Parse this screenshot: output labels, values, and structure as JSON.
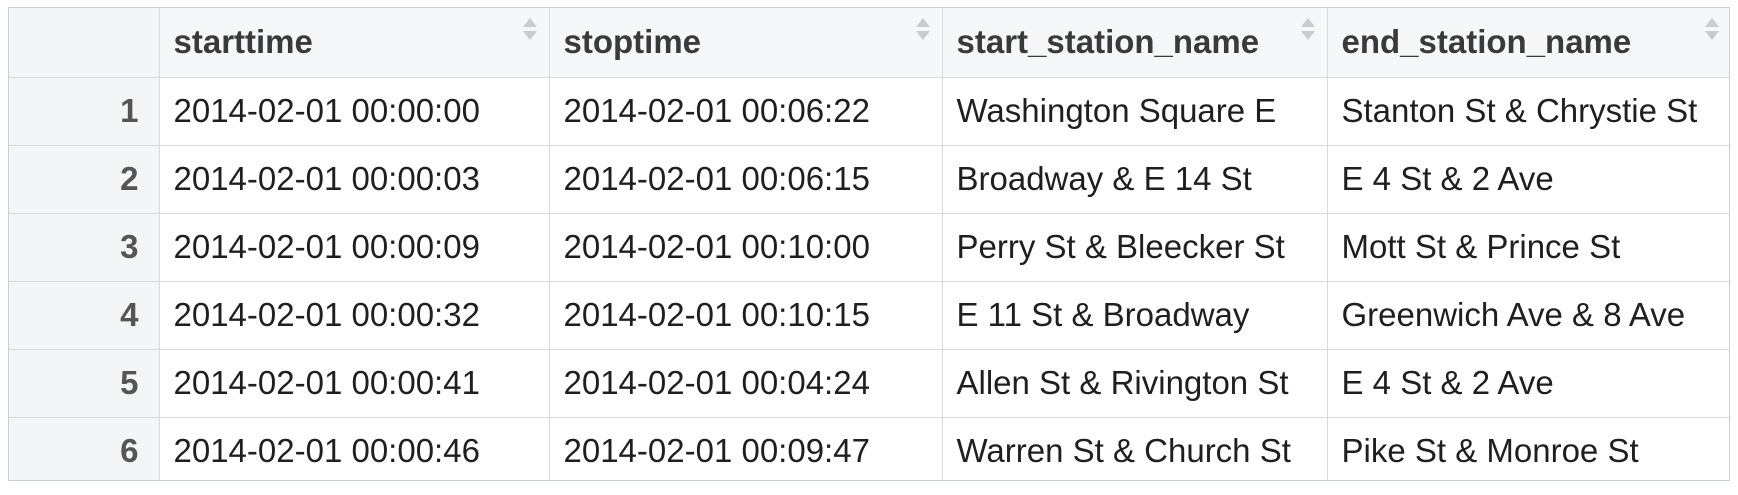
{
  "table": {
    "columns": [
      {
        "label": ""
      },
      {
        "label": "starttime"
      },
      {
        "label": "stoptime"
      },
      {
        "label": "start_station_name"
      },
      {
        "label": "end_station_name"
      }
    ],
    "rows": [
      {
        "idx": "1",
        "starttime": "2014-02-01 00:00:00",
        "stoptime": "2014-02-01 00:06:22",
        "start_station_name": "Washington Square E",
        "end_station_name": "Stanton St & Chrystie St"
      },
      {
        "idx": "2",
        "starttime": "2014-02-01 00:00:03",
        "stoptime": "2014-02-01 00:06:15",
        "start_station_name": "Broadway & E 14 St",
        "end_station_name": "E 4 St & 2 Ave"
      },
      {
        "idx": "3",
        "starttime": "2014-02-01 00:00:09",
        "stoptime": "2014-02-01 00:10:00",
        "start_station_name": "Perry St & Bleecker St",
        "end_station_name": "Mott St & Prince St"
      },
      {
        "idx": "4",
        "starttime": "2014-02-01 00:00:32",
        "stoptime": "2014-02-01 00:10:15",
        "start_station_name": "E 11 St & Broadway",
        "end_station_name": "Greenwich Ave & 8 Ave"
      },
      {
        "idx": "5",
        "starttime": "2014-02-01 00:00:41",
        "stoptime": "2014-02-01 00:04:24",
        "start_station_name": "Allen St & Rivington St",
        "end_station_name": "E 4 St & 2 Ave"
      },
      {
        "idx": "6",
        "starttime": "2014-02-01 00:00:46",
        "stoptime": "2014-02-01 00:09:47",
        "start_station_name": "Warren St & Church St",
        "end_station_name": "Pike St & Monroe St"
      }
    ]
  },
  "icons": {
    "sort": "sort-icon"
  },
  "colors": {
    "border": "#d5dae0",
    "header_bg": "#f6f7f9",
    "index_bg": "#f4f5f7",
    "text": "#1f1f1f"
  }
}
